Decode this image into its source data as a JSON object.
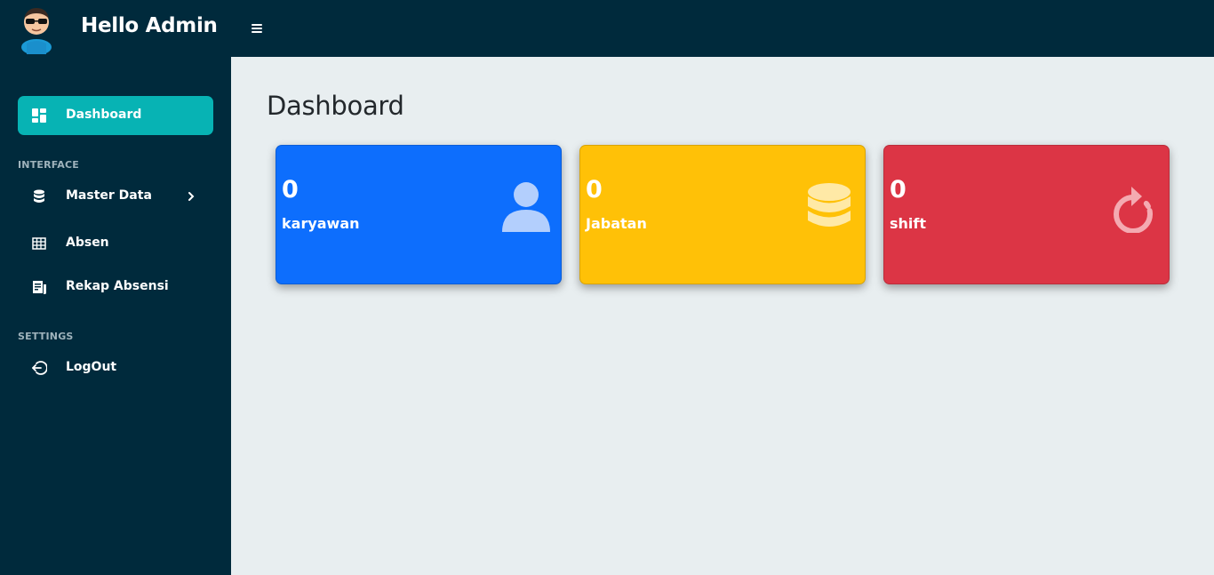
{
  "header": {
    "title": "Hello Admin",
    "avatar_icon": "admin-avatar-icon",
    "menu_icon": "hamburger-icon",
    "background_color": "#002a3c"
  },
  "sidebar": {
    "items": [
      {
        "label": "Dashboard",
        "icon": "dashboard-icon",
        "active": true
      },
      {
        "label": "Master Data",
        "icon": "database-icon",
        "has_submenu": true
      },
      {
        "label": "Absen",
        "icon": "table-icon"
      },
      {
        "label": "Rekap Absensi",
        "icon": "report-icon"
      },
      {
        "label": "LogOut",
        "icon": "logout-icon"
      }
    ],
    "sections": [
      "INTERFACE",
      "SETTINGS"
    ],
    "active_color": "#07b3b4"
  },
  "main": {
    "title": "Dashboard",
    "cards": [
      {
        "count": "0",
        "label": "karyawan",
        "icon": "user-icon",
        "color": "#0d6efd"
      },
      {
        "count": "0",
        "label": "Jabatan",
        "icon": "database-icon",
        "color": "#ffc107"
      },
      {
        "count": "0",
        "label": "shift",
        "icon": "refresh-icon",
        "color": "#dc3545"
      }
    ]
  }
}
